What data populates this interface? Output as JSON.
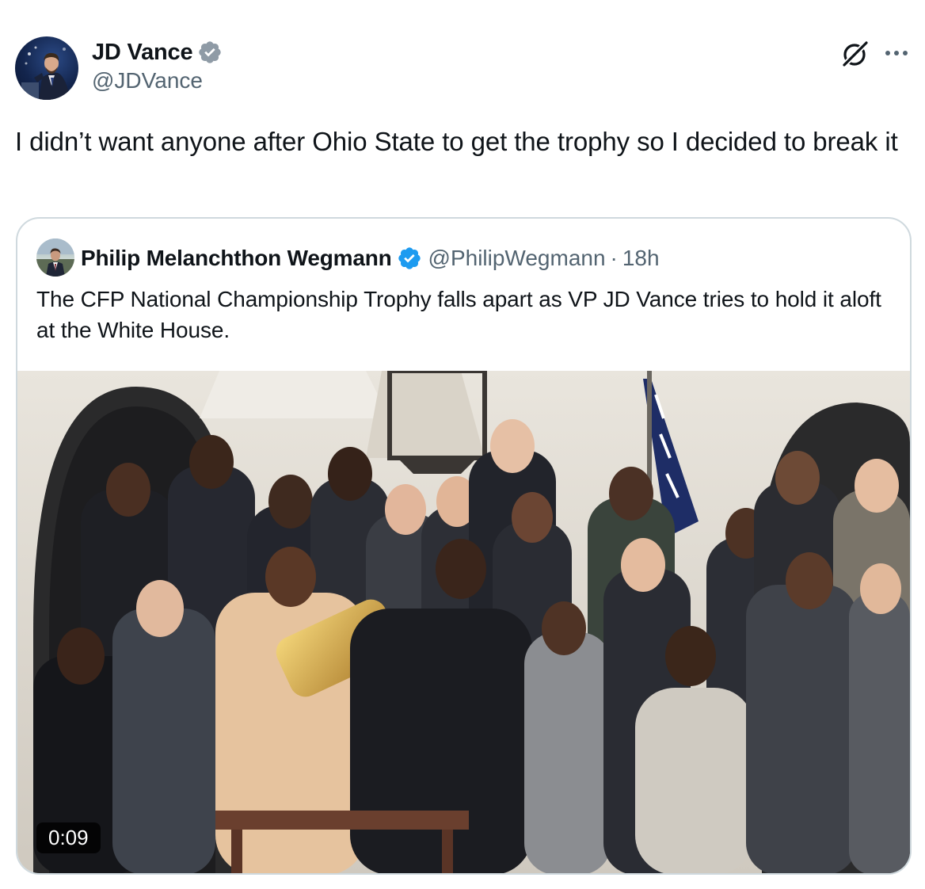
{
  "post": {
    "author_name": "JD Vance",
    "author_handle": "@JDVance",
    "verified_icon": "verified-badge-icon",
    "text": "I didn’t want anyone after Ohio State to get the trophy so I decided to break it"
  },
  "quoted_post": {
    "author_name": "Philip Melanchthon Wegmann",
    "author_handle": "@PhilipWegmann",
    "separator": "·",
    "time": "18h",
    "text": "The CFP National Championship Trophy falls apart as VP JD Vance tries to hold it aloft at the White House.",
    "video_duration": "0:09"
  },
  "icons": {
    "grok": "grok-icon",
    "more": "more-options-icon"
  },
  "colors": {
    "verified_blue": "#1d9bf0",
    "secondary_text": "#536471",
    "border": "#cfd9de"
  }
}
